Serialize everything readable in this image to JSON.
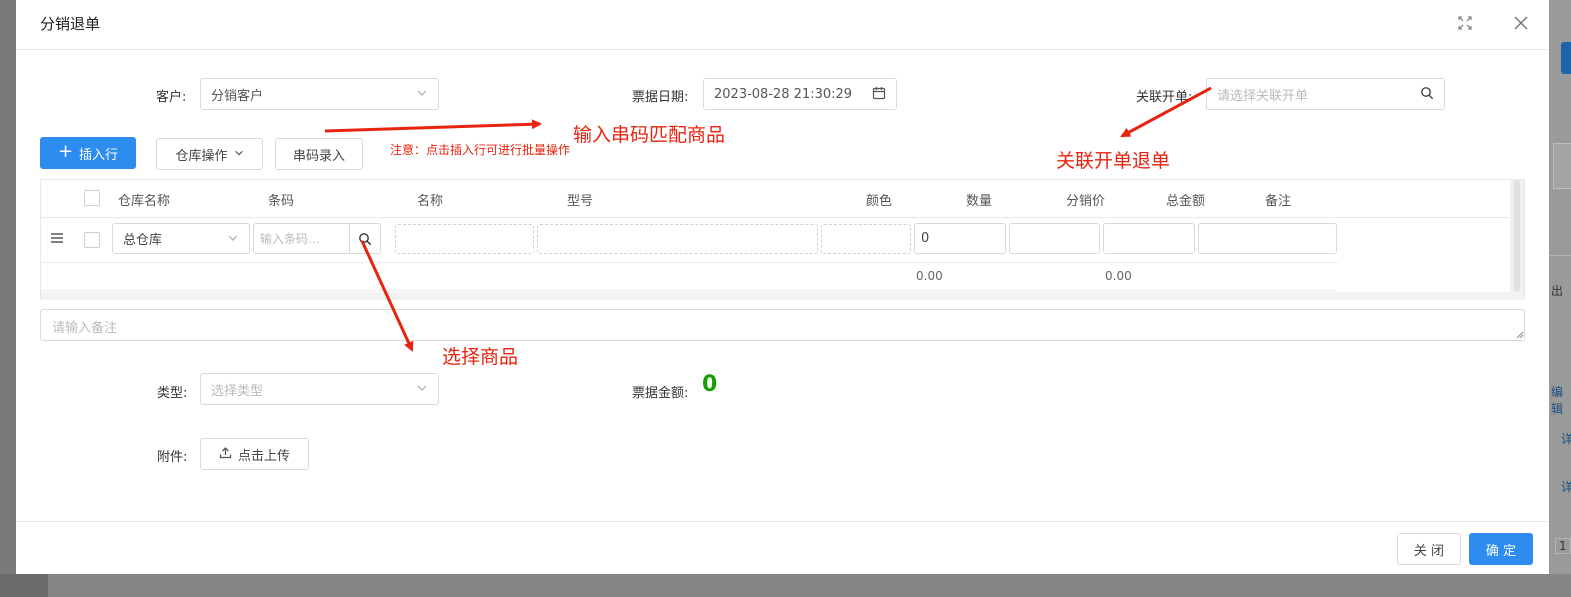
{
  "modal": {
    "title": "分销退单"
  },
  "form": {
    "customer_label": "客户:",
    "customer_value": "分销客户",
    "date_label": "票据日期:",
    "date_value": "2023-08-28 21:30:29",
    "related_label": "关联开单:",
    "related_placeholder": "请选择关联开单"
  },
  "toolbar": {
    "insert_row": "插入行",
    "warehouse_ops": "仓库操作",
    "serial_entry": "串码录入",
    "note": "注意：点击插入行可进行批量操作"
  },
  "table": {
    "columns": [
      "仓库名称",
      "条码",
      "名称",
      "型号",
      "颜色",
      "数量",
      "分销价",
      "总金额",
      "备注"
    ],
    "row": {
      "warehouse": "总仓库",
      "barcode_placeholder": "输入条码...",
      "quantity": "0"
    },
    "summary": {
      "quantity_total": "0.00",
      "amount_total": "0.00"
    }
  },
  "remark_placeholder": "请输入备注",
  "type_label": "类型:",
  "type_placeholder": "选择类型",
  "bill_amount_label": "票据金额:",
  "bill_amount_value": "0",
  "attachment_label": "附件:",
  "upload_label": "点击上传",
  "footer": {
    "close": "关 闭",
    "confirm": "确 定"
  },
  "annotations": {
    "serial_match": "输入串码匹配商品",
    "related_return": "关联开单退单",
    "select_product": "选择商品"
  },
  "background": {
    "side_texts": [
      "出",
      "编辑",
      "详",
      "详",
      "1"
    ]
  },
  "colors": {
    "primary": "#2d8cf0",
    "annotation_red": "#e8230f",
    "amount_green": "#15a000"
  }
}
